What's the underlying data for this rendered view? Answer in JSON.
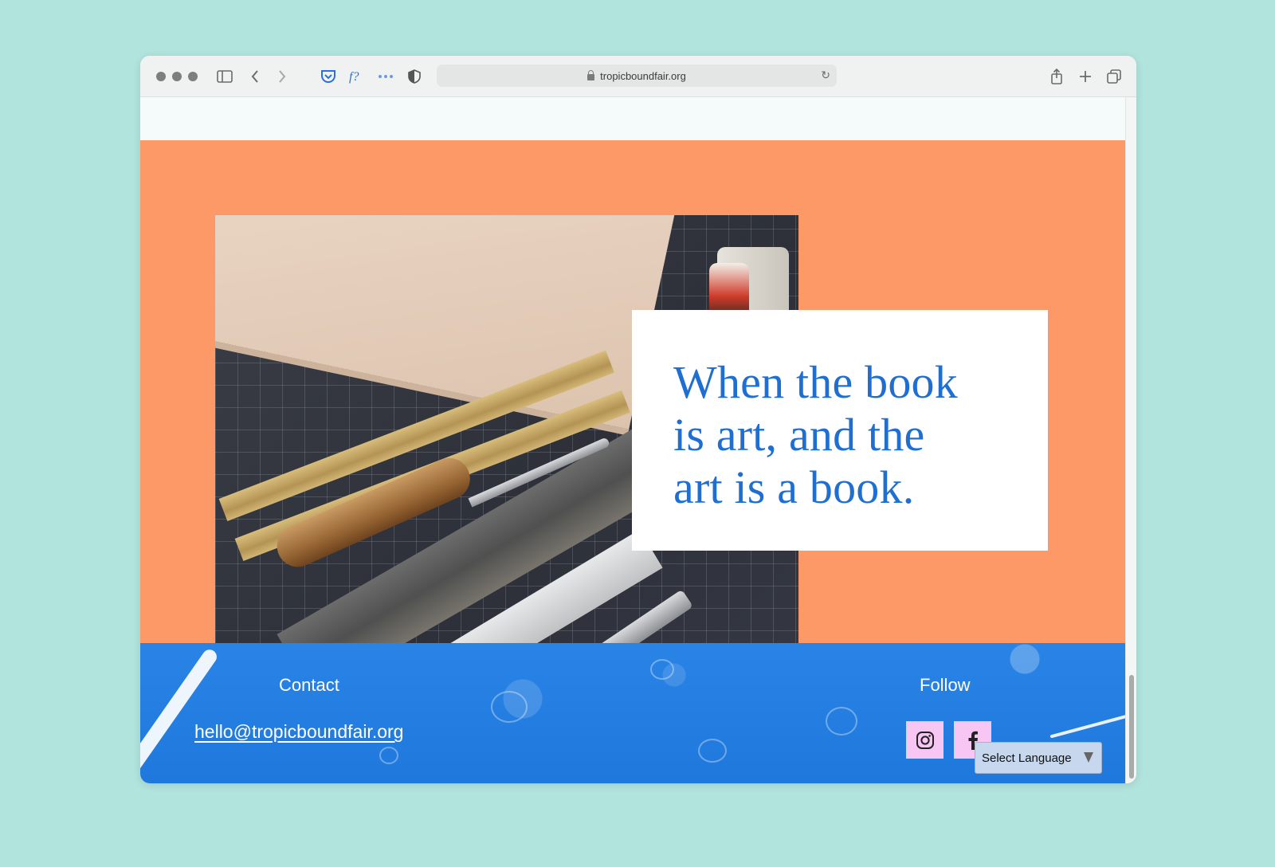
{
  "browser": {
    "url": "tropicboundfair.org"
  },
  "hero": {
    "quote_lines": [
      "When the book",
      "is art, and the",
      "art is a book."
    ]
  },
  "footer": {
    "contact_title": "Contact",
    "email": "hello@tropicboundfair.org",
    "follow_title": "Follow",
    "social": [
      {
        "name": "instagram-icon"
      },
      {
        "name": "facebook-icon"
      }
    ],
    "language_select": "Select Language"
  },
  "colors": {
    "page_bg": "#b1e4dd",
    "orange_band": "#fd9967",
    "quote_text": "#1f6fd3",
    "footer_blue": "#2a84e6",
    "social_bg": "#f7c6f2"
  }
}
